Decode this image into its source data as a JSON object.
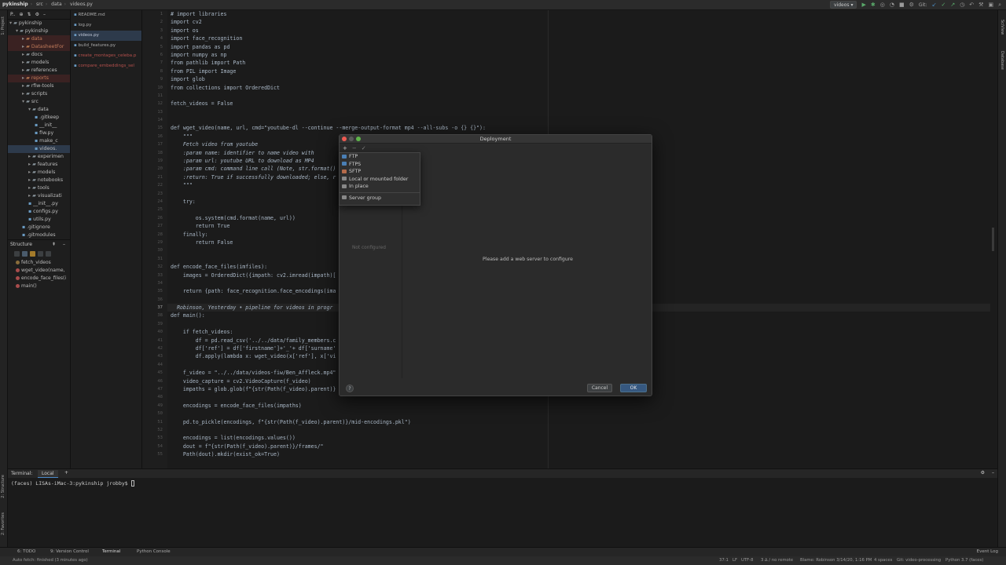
{
  "nav": {
    "crumbs": [
      "pykinship",
      "src",
      "data",
      "videos.py"
    ],
    "run_config": "videos",
    "git_label": "Git:"
  },
  "left_tabs": [
    "1: Project",
    "2: Structure",
    "2: Favorites"
  ],
  "right_tabs": [
    "SciView",
    "Database"
  ],
  "project": {
    "header": "P..",
    "tree": [
      {
        "label": "pykinship",
        "depth": 0,
        "type": "folder",
        "open": true
      },
      {
        "label": "pykinship",
        "depth": 1,
        "type": "folder",
        "open": true
      },
      {
        "label": "data",
        "depth": 2,
        "type": "folder",
        "highlight": "red"
      },
      {
        "label": "DatasheetFor",
        "depth": 2,
        "type": "folder",
        "highlight": "red"
      },
      {
        "label": "docs",
        "depth": 2,
        "type": "folder"
      },
      {
        "label": "models",
        "depth": 2,
        "type": "folder"
      },
      {
        "label": "references",
        "depth": 2,
        "type": "folder"
      },
      {
        "label": "reports",
        "depth": 2,
        "type": "folder",
        "highlight": "red"
      },
      {
        "label": "rfiw-tools",
        "depth": 2,
        "type": "folder"
      },
      {
        "label": "scripts",
        "depth": 2,
        "type": "folder"
      },
      {
        "label": "src",
        "depth": 2,
        "type": "folder",
        "open": true
      },
      {
        "label": "data",
        "depth": 3,
        "type": "folder",
        "open": true
      },
      {
        "label": ".gitkeep",
        "depth": 4,
        "type": "file"
      },
      {
        "label": "__init__",
        "depth": 4,
        "type": "file"
      },
      {
        "label": "fiw.py",
        "depth": 4,
        "type": "file"
      },
      {
        "label": "make_c",
        "depth": 4,
        "type": "file"
      },
      {
        "label": "videos.",
        "depth": 4,
        "type": "file",
        "selected": true
      },
      {
        "label": "experimen",
        "depth": 3,
        "type": "folder"
      },
      {
        "label": "features",
        "depth": 3,
        "type": "folder"
      },
      {
        "label": "models",
        "depth": 3,
        "type": "folder"
      },
      {
        "label": "notebooks",
        "depth": 3,
        "type": "folder"
      },
      {
        "label": "tools",
        "depth": 3,
        "type": "folder"
      },
      {
        "label": "visualizati",
        "depth": 3,
        "type": "folder"
      },
      {
        "label": "__init__.py",
        "depth": 3,
        "type": "file"
      },
      {
        "label": "configs.py",
        "depth": 3,
        "type": "file"
      },
      {
        "label": "utils.py",
        "depth": 3,
        "type": "file"
      },
      {
        "label": ".gitignore",
        "depth": 2,
        "type": "file"
      },
      {
        "label": ".gitmodules",
        "depth": 2,
        "type": "file"
      }
    ]
  },
  "open_files": [
    {
      "label": "README.md",
      "state": "normal"
    },
    {
      "label": "log.py",
      "state": "normal"
    },
    {
      "label": "videos.py",
      "state": "selected"
    },
    {
      "label": "build_features.py",
      "state": "normal"
    },
    {
      "label": "create_montages_celeba.p",
      "state": "error"
    },
    {
      "label": "compare_embeddings_sel",
      "state": "error"
    }
  ],
  "structure": {
    "header": "Structure",
    "items": [
      "fetch_videos",
      "wget_video(name,",
      "encode_face_files(i",
      "main()"
    ]
  },
  "code_lines": [
    {
      "n": "1",
      "t": "# import libraries",
      "cls": "c"
    },
    {
      "n": "2",
      "t": "import cv2"
    },
    {
      "n": "3",
      "t": "import os"
    },
    {
      "n": "4",
      "t": "import face_recognition"
    },
    {
      "n": "5",
      "t": "import pandas as pd"
    },
    {
      "n": "6",
      "t": "import numpy as np"
    },
    {
      "n": "7",
      "t": "from pathlib import Path"
    },
    {
      "n": "8",
      "t": "from PIL import Image"
    },
    {
      "n": "9",
      "t": "import glob"
    },
    {
      "n": "10",
      "t": "from collections import OrderedDict"
    },
    {
      "n": "11",
      "t": ""
    },
    {
      "n": "12",
      "t": "fetch_videos = False"
    },
    {
      "n": "13",
      "t": ""
    },
    {
      "n": "14",
      "t": ""
    },
    {
      "n": "15",
      "t": "def wget_video(name, url, cmd=\"youtube-dl --continue --merge-output-format mp4 --all-subs -o {} {}\"):"
    },
    {
      "n": "16",
      "t": "    \"\"\"",
      "cls": "d"
    },
    {
      "n": "17",
      "t": "    Fetch video from youtube",
      "cls": "d"
    },
    {
      "n": "18",
      "t": "    :param name: identifier to name video with",
      "cls": "d"
    },
    {
      "n": "19",
      "t": "    :param url: youtube URL to download as MP4",
      "cls": "d"
    },
    {
      "n": "20",
      "t": "    :param cmd: command line call (Note, str.format()",
      "cls": "d"
    },
    {
      "n": "21",
      "t": "    :return: True if successfully downloaded; else, r",
      "cls": "d"
    },
    {
      "n": "22",
      "t": "    \"\"\"",
      "cls": "d"
    },
    {
      "n": "23",
      "t": ""
    },
    {
      "n": "24",
      "t": "    try:"
    },
    {
      "n": "25",
      "t": ""
    },
    {
      "n": "26",
      "t": "        os.system(cmd.format(name, url))"
    },
    {
      "n": "27",
      "t": "        return True"
    },
    {
      "n": "28",
      "t": "    finally:"
    },
    {
      "n": "29",
      "t": "        return False"
    },
    {
      "n": "30",
      "t": ""
    },
    {
      "n": "31",
      "t": ""
    },
    {
      "n": "32",
      "t": "def encode_face_files(imfiles):"
    },
    {
      "n": "33",
      "t": "    images = OrderedDict({impath: cv2.imread(impath)["
    },
    {
      "n": "34",
      "t": ""
    },
    {
      "n": "35",
      "t": "    return {path: face_recognition.face_encodings(ima"
    },
    {
      "n": "36",
      "t": ""
    },
    {
      "n": "37",
      "t": "  Robinson, Yesterday • pipeline for videos in progr",
      "cls": "hint",
      "current": true
    },
    {
      "n": "38",
      "t": "def main():"
    },
    {
      "n": "39",
      "t": ""
    },
    {
      "n": "40",
      "t": "    if fetch_videos:"
    },
    {
      "n": "41",
      "t": "        df = pd.read_csv('../../data/family_members.c"
    },
    {
      "n": "42",
      "t": "        df['ref'] = df['firstname']+'_'+ df['surname'"
    },
    {
      "n": "43",
      "t": "        df.apply(lambda x: wget_video(x['ref'], x['vi"
    },
    {
      "n": "44",
      "t": ""
    },
    {
      "n": "45",
      "t": "    f_video = \"../../data/videos-fiw/Ben_Affleck.mp4\""
    },
    {
      "n": "46",
      "t": "    video_capture = cv2.VideoCapture(f_video)"
    },
    {
      "n": "47",
      "t": "    impaths = glob.glob(f\"{str(Path(f_video).parent)}"
    },
    {
      "n": "48",
      "t": ""
    },
    {
      "n": "49",
      "t": "    encodings = encode_face_files(impaths)"
    },
    {
      "n": "50",
      "t": ""
    },
    {
      "n": "51",
      "t": "    pd.to_pickle(encodings, f\"{str(Path(f_video).parent)}/mid-encodings.pkl\")"
    },
    {
      "n": "52",
      "t": ""
    },
    {
      "n": "53",
      "t": "    encodings = list(encodings.values())"
    },
    {
      "n": "54",
      "t": "    dout = f\"{str(Path(f_video).parent)}/frames/\""
    },
    {
      "n": "55",
      "t": "    Path(dout).mkdir(exist_ok=True)"
    }
  ],
  "dialog": {
    "title": "Deployment",
    "not_configured": "Not configured",
    "message": "Please add a web server to configure",
    "cancel": "Cancel",
    "ok": "OK",
    "help": "?"
  },
  "popup": {
    "items": [
      {
        "label": "FTP",
        "color": "#4a7fb5"
      },
      {
        "label": "FTPS",
        "color": "#4a7fb5"
      },
      {
        "label": "SFTP",
        "color": "#b56b4a"
      },
      {
        "label": "Local or mounted folder",
        "color": "#888888"
      },
      {
        "label": "In place",
        "color": "#888888"
      }
    ],
    "group": "Server group"
  },
  "terminal": {
    "label": "Terminal:",
    "tab": "Local",
    "add": "+",
    "prompt": "(faces) LISAs-iMac-3:pykinship jrobby$ "
  },
  "bottom_tools": [
    "6: TODO",
    "9: Version Control",
    "Terminal",
    "Python Console",
    "Event Log"
  ],
  "status": {
    "left": "Auto fetch: finished (3 minutes ago)",
    "pos": "37:1",
    "lf": "LF",
    "enc": "UTF-8",
    "remote": "3 ∆ / no remote",
    "blame": "Blame: Robinson 3/14/20, 1:16 PM",
    "indent": "4 spaces",
    "branch": "Git: video-processing",
    "interp": "Python 3.7 (faces)"
  }
}
